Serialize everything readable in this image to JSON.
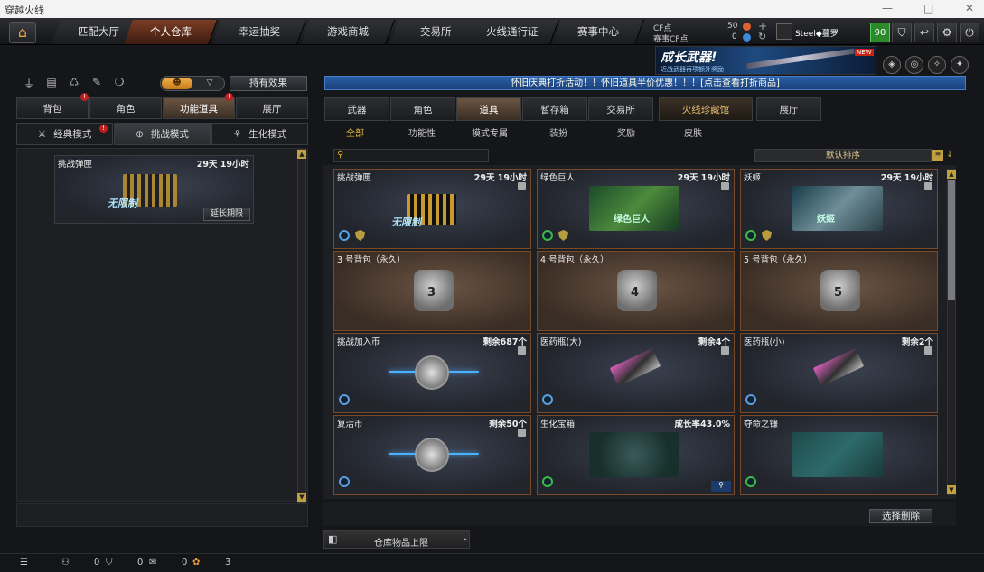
{
  "window": {
    "title": "穿越火线"
  },
  "nav": {
    "tabs": [
      "匹配大厅",
      "个人仓库",
      "幸运抽奖",
      "游戏商城",
      "交易所",
      "火线通行证",
      "赛事中心"
    ],
    "active": "个人仓库"
  },
  "currency": {
    "cf_label": "CF点",
    "cf_value": "50",
    "match_label": "赛事CF点",
    "match_value": "0"
  },
  "user": {
    "name": "Steel◆蔓罗",
    "level": "90"
  },
  "banner": {
    "title": "成长武器!",
    "subtitle": "近战武器再项额外奖励",
    "badge": "NEW"
  },
  "left": {
    "toggle_left": "☻",
    "toggle_right": "▽",
    "effect_button": "持有效果",
    "tabs": [
      "背包",
      "角色",
      "功能道具",
      "展厅"
    ],
    "active_tab": "功能道具",
    "modes": [
      "经典模式",
      "挑战模式",
      "生化模式"
    ],
    "active_mode": "挑战模式",
    "item": {
      "name": "挑战弹匣",
      "time": "29天 19小时",
      "img_label": "无限制",
      "extend": "延长期限"
    }
  },
  "notice": "怀旧庆典打折活动！！怀旧道具半价优惠！！！[点击查看打折商品]",
  "right": {
    "tabs": [
      "武器",
      "角色",
      "道具",
      "暂存箱",
      "交易所",
      "火线珍藏馆",
      "展厅"
    ],
    "active_tab": "道具",
    "subtabs": [
      "全部",
      "功能性",
      "模式专属",
      "装扮",
      "奖励",
      "皮肤"
    ],
    "active_subtab": "全部",
    "search_placeholder": "",
    "sort": "默认排序",
    "items": [
      {
        "name": "挑战弹匣",
        "tag": "29天 19小时",
        "img": "无限制",
        "kind": "ammo"
      },
      {
        "name": "绿色巨人",
        "tag": "29天 19小时",
        "img": "绿色巨人",
        "kind": "hero"
      },
      {
        "name": "妖姬",
        "tag": "29天 19小时",
        "img": "妖姬",
        "kind": "hero2"
      },
      {
        "name": "3 号背包（永久）",
        "tag": "",
        "img": "3",
        "kind": "bag"
      },
      {
        "name": "4 号背包（永久）",
        "tag": "",
        "img": "4",
        "kind": "bag"
      },
      {
        "name": "5 号背包（永久）",
        "tag": "",
        "img": "5",
        "kind": "bag"
      },
      {
        "name": "挑战加入币",
        "tag": "剩余687个",
        "img": "",
        "kind": "coin"
      },
      {
        "name": "医药瓶(大)",
        "tag": "剩余4个",
        "img": "",
        "kind": "gun"
      },
      {
        "name": "医药瓶(小)",
        "tag": "剩余2个",
        "img": "",
        "kind": "gun"
      },
      {
        "name": "复活币",
        "tag": "剩余50个",
        "img": "",
        "kind": "revive"
      },
      {
        "name": "生化宝箱",
        "tag": "成长率43.0%",
        "img": "",
        "kind": "box"
      },
      {
        "name": "夺命之镰",
        "tag": "",
        "img": "",
        "kind": "scythe"
      }
    ],
    "delete_button": "选择删除",
    "capacity": "仓库物品上限"
  },
  "bottom": {
    "c1": "0",
    "c2": "0",
    "c3": "0",
    "c4": "3"
  },
  "colors": {
    "accent": "#c0a040",
    "frame": "#7a4a28",
    "notice": "#2a5fa8"
  }
}
